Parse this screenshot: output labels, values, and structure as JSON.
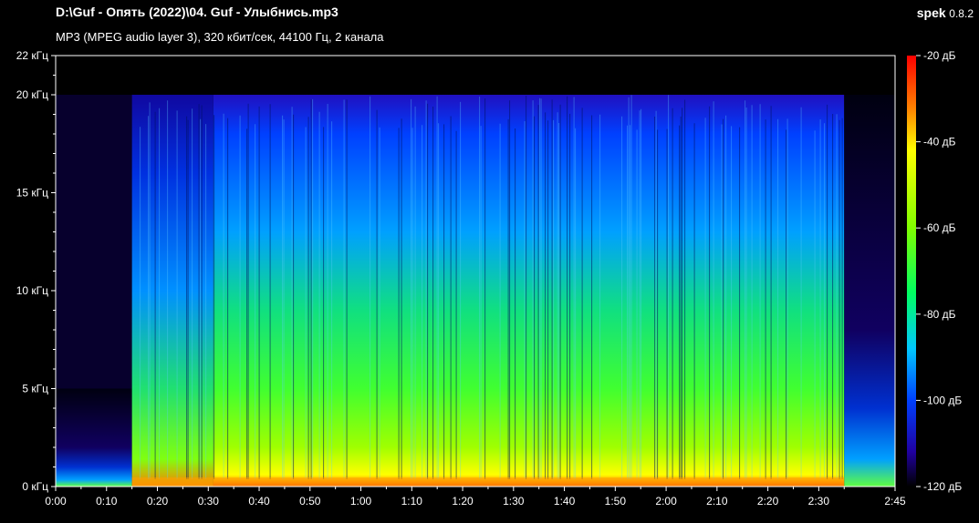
{
  "header": {
    "title": "D:\\Guf - Опять (2022)\\04. Guf - Улыбнись.mp3",
    "subtitle": "MP3 (MPEG audio layer 3), 320 кбит/сек, 44100 Гц, 2 канала",
    "app_name": "spek",
    "app_version": "0.8.2"
  },
  "colors": {
    "background": "#000000",
    "scale_gradient": [
      "#ff0000",
      "#ff8000",
      "#ffff00",
      "#80ff00",
      "#00ff40",
      "#00c8ff",
      "#0040ff",
      "#2000a0",
      "#000000"
    ]
  },
  "chart_data": {
    "type": "heatmap",
    "title": "",
    "xlabel": "",
    "ylabel": "",
    "xlim": [
      0,
      165
    ],
    "ylim": [
      0,
      22
    ],
    "x_unit_seconds": true,
    "x_ticks": [
      {
        "v": 0,
        "label": "0:00"
      },
      {
        "v": 10,
        "label": "0:10"
      },
      {
        "v": 20,
        "label": "0:20"
      },
      {
        "v": 30,
        "label": "0:30"
      },
      {
        "v": 40,
        "label": "0:40"
      },
      {
        "v": 50,
        "label": "0:50"
      },
      {
        "v": 60,
        "label": "1:00"
      },
      {
        "v": 70,
        "label": "1:10"
      },
      {
        "v": 80,
        "label": "1:20"
      },
      {
        "v": 90,
        "label": "1:30"
      },
      {
        "v": 100,
        "label": "1:40"
      },
      {
        "v": 110,
        "label": "1:50"
      },
      {
        "v": 120,
        "label": "2:00"
      },
      {
        "v": 130,
        "label": "2:10"
      },
      {
        "v": 140,
        "label": "2:20"
      },
      {
        "v": 150,
        "label": "2:30"
      },
      {
        "v": 165,
        "label": "2:45"
      }
    ],
    "y_ticks": [
      {
        "v": 0,
        "label": "0 кГц"
      },
      {
        "v": 5,
        "label": "5 кГц"
      },
      {
        "v": 10,
        "label": "10 кГц"
      },
      {
        "v": 15,
        "label": "15 кГц"
      },
      {
        "v": 20,
        "label": "20 кГц"
      },
      {
        "v": 22,
        "label": "22 кГц"
      }
    ],
    "colorbar": {
      "range_db": [
        -120,
        -20
      ],
      "ticks": [
        {
          "v": -20,
          "label": "-20 дБ"
        },
        {
          "v": -40,
          "label": "-40 дБ"
        },
        {
          "v": -60,
          "label": "-60 дБ"
        },
        {
          "v": -80,
          "label": "-80 дБ"
        },
        {
          "v": -100,
          "label": "-100 дБ"
        },
        {
          "v": -120,
          "label": "-120 дБ"
        }
      ]
    },
    "cutoff_khz": 20,
    "segments": [
      {
        "start": 0,
        "end": 15,
        "level": "low",
        "note_max_khz": 5
      },
      {
        "start": 15,
        "end": 31,
        "level": "mid"
      },
      {
        "start": 31,
        "end": 155,
        "level": "high"
      },
      {
        "start": 155,
        "end": 165,
        "level": "low"
      }
    ]
  }
}
